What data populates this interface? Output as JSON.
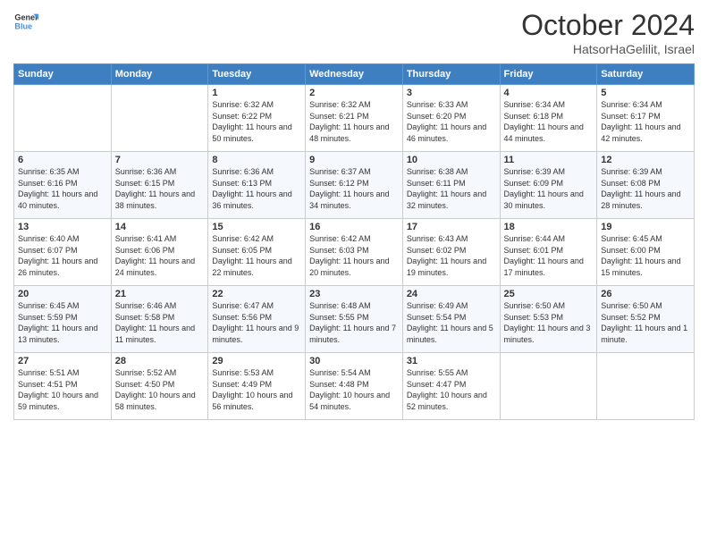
{
  "header": {
    "logo": {
      "line1": "General",
      "line2": "Blue"
    },
    "title": "October 2024",
    "subtitle": "HatsorHaGelilit, Israel"
  },
  "weekdays": [
    "Sunday",
    "Monday",
    "Tuesday",
    "Wednesday",
    "Thursday",
    "Friday",
    "Saturday"
  ],
  "weeks": [
    [
      {
        "day": "",
        "info": ""
      },
      {
        "day": "",
        "info": ""
      },
      {
        "day": "1",
        "info": "Sunrise: 6:32 AM\nSunset: 6:22 PM\nDaylight: 11 hours and 50 minutes."
      },
      {
        "day": "2",
        "info": "Sunrise: 6:32 AM\nSunset: 6:21 PM\nDaylight: 11 hours and 48 minutes."
      },
      {
        "day": "3",
        "info": "Sunrise: 6:33 AM\nSunset: 6:20 PM\nDaylight: 11 hours and 46 minutes."
      },
      {
        "day": "4",
        "info": "Sunrise: 6:34 AM\nSunset: 6:18 PM\nDaylight: 11 hours and 44 minutes."
      },
      {
        "day": "5",
        "info": "Sunrise: 6:34 AM\nSunset: 6:17 PM\nDaylight: 11 hours and 42 minutes."
      }
    ],
    [
      {
        "day": "6",
        "info": "Sunrise: 6:35 AM\nSunset: 6:16 PM\nDaylight: 11 hours and 40 minutes."
      },
      {
        "day": "7",
        "info": "Sunrise: 6:36 AM\nSunset: 6:15 PM\nDaylight: 11 hours and 38 minutes."
      },
      {
        "day": "8",
        "info": "Sunrise: 6:36 AM\nSunset: 6:13 PM\nDaylight: 11 hours and 36 minutes."
      },
      {
        "day": "9",
        "info": "Sunrise: 6:37 AM\nSunset: 6:12 PM\nDaylight: 11 hours and 34 minutes."
      },
      {
        "day": "10",
        "info": "Sunrise: 6:38 AM\nSunset: 6:11 PM\nDaylight: 11 hours and 32 minutes."
      },
      {
        "day": "11",
        "info": "Sunrise: 6:39 AM\nSunset: 6:09 PM\nDaylight: 11 hours and 30 minutes."
      },
      {
        "day": "12",
        "info": "Sunrise: 6:39 AM\nSunset: 6:08 PM\nDaylight: 11 hours and 28 minutes."
      }
    ],
    [
      {
        "day": "13",
        "info": "Sunrise: 6:40 AM\nSunset: 6:07 PM\nDaylight: 11 hours and 26 minutes."
      },
      {
        "day": "14",
        "info": "Sunrise: 6:41 AM\nSunset: 6:06 PM\nDaylight: 11 hours and 24 minutes."
      },
      {
        "day": "15",
        "info": "Sunrise: 6:42 AM\nSunset: 6:05 PM\nDaylight: 11 hours and 22 minutes."
      },
      {
        "day": "16",
        "info": "Sunrise: 6:42 AM\nSunset: 6:03 PM\nDaylight: 11 hours and 20 minutes."
      },
      {
        "day": "17",
        "info": "Sunrise: 6:43 AM\nSunset: 6:02 PM\nDaylight: 11 hours and 19 minutes."
      },
      {
        "day": "18",
        "info": "Sunrise: 6:44 AM\nSunset: 6:01 PM\nDaylight: 11 hours and 17 minutes."
      },
      {
        "day": "19",
        "info": "Sunrise: 6:45 AM\nSunset: 6:00 PM\nDaylight: 11 hours and 15 minutes."
      }
    ],
    [
      {
        "day": "20",
        "info": "Sunrise: 6:45 AM\nSunset: 5:59 PM\nDaylight: 11 hours and 13 minutes."
      },
      {
        "day": "21",
        "info": "Sunrise: 6:46 AM\nSunset: 5:58 PM\nDaylight: 11 hours and 11 minutes."
      },
      {
        "day": "22",
        "info": "Sunrise: 6:47 AM\nSunset: 5:56 PM\nDaylight: 11 hours and 9 minutes."
      },
      {
        "day": "23",
        "info": "Sunrise: 6:48 AM\nSunset: 5:55 PM\nDaylight: 11 hours and 7 minutes."
      },
      {
        "day": "24",
        "info": "Sunrise: 6:49 AM\nSunset: 5:54 PM\nDaylight: 11 hours and 5 minutes."
      },
      {
        "day": "25",
        "info": "Sunrise: 6:50 AM\nSunset: 5:53 PM\nDaylight: 11 hours and 3 minutes."
      },
      {
        "day": "26",
        "info": "Sunrise: 6:50 AM\nSunset: 5:52 PM\nDaylight: 11 hours and 1 minute."
      }
    ],
    [
      {
        "day": "27",
        "info": "Sunrise: 5:51 AM\nSunset: 4:51 PM\nDaylight: 10 hours and 59 minutes."
      },
      {
        "day": "28",
        "info": "Sunrise: 5:52 AM\nSunset: 4:50 PM\nDaylight: 10 hours and 58 minutes."
      },
      {
        "day": "29",
        "info": "Sunrise: 5:53 AM\nSunset: 4:49 PM\nDaylight: 10 hours and 56 minutes."
      },
      {
        "day": "30",
        "info": "Sunrise: 5:54 AM\nSunset: 4:48 PM\nDaylight: 10 hours and 54 minutes."
      },
      {
        "day": "31",
        "info": "Sunrise: 5:55 AM\nSunset: 4:47 PM\nDaylight: 10 hours and 52 minutes."
      },
      {
        "day": "",
        "info": ""
      },
      {
        "day": "",
        "info": ""
      }
    ]
  ]
}
